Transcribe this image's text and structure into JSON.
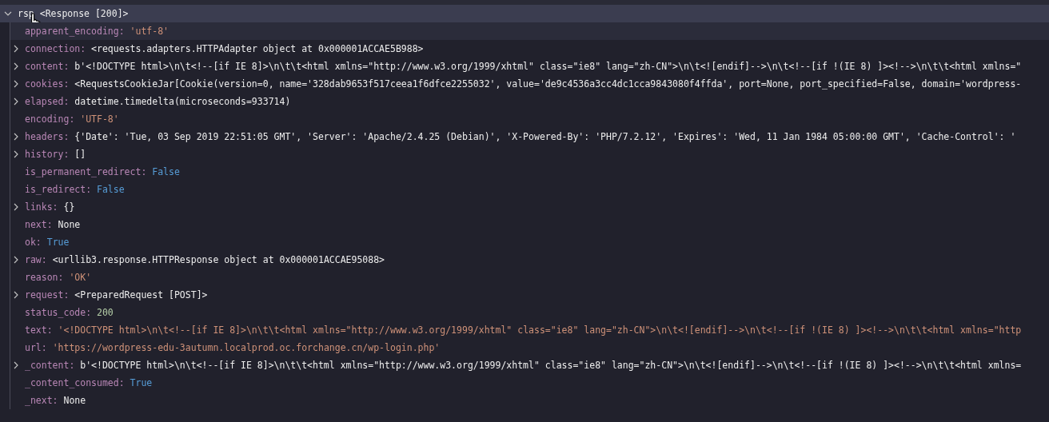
{
  "variable": {
    "name": "rsp",
    "value": "<Response [200]>",
    "expanded": true,
    "highlighted": true,
    "children": [
      {
        "name": "apparent_encoding:",
        "value": "'utf-8'",
        "kind": "string",
        "expandable": false,
        "highlighted": true
      },
      {
        "name": "connection:",
        "value": "<requests.adapters.HTTPAdapter object at 0x000001ACCAE5B988>",
        "kind": "object",
        "expandable": true,
        "expanded": false,
        "highlighted": false
      },
      {
        "name": "content:",
        "value": "b'<!DOCTYPE html>\\n\\t<!--[if IE 8]>\\n\\t\\t<html xmlns=\"http://www.w3.org/1999/xhtml\" class=\"ie8\" lang=\"zh-CN\">\\n\\t<![endif]-->\\n\\t<!--[if !(IE 8) ]><!-->\\n\\t\\t<html xmlns=\"",
        "kind": "object",
        "expandable": true,
        "expanded": false,
        "highlighted": false
      },
      {
        "name": "cookies:",
        "value": "<RequestsCookieJar[Cookie(version=0, name='328dab9653f517ceea1f6dfce2255032', value='de9c4536a3cc4dc1cca9843080f4ffda', port=None, port_specified=False, domain='wordpress-",
        "kind": "object",
        "expandable": true,
        "expanded": false,
        "highlighted": false
      },
      {
        "name": "elapsed:",
        "value": "datetime.timedelta(microseconds=933714)",
        "kind": "object",
        "expandable": true,
        "expanded": false,
        "highlighted": false
      },
      {
        "name": "encoding:",
        "value": "'UTF-8'",
        "kind": "string",
        "expandable": false,
        "highlighted": false
      },
      {
        "name": "headers:",
        "value": "{'Date': 'Tue, 03 Sep 2019 22:51:05 GMT', 'Server': 'Apache/2.4.25 (Debian)', 'X-Powered-By': 'PHP/7.2.12', 'Expires': 'Wed, 11 Jan 1984 05:00:00 GMT', 'Cache-Control': '",
        "kind": "object",
        "expandable": true,
        "expanded": false,
        "highlighted": false
      },
      {
        "name": "history:",
        "value": "[]",
        "kind": "object",
        "expandable": true,
        "expanded": false,
        "highlighted": false
      },
      {
        "name": "is_permanent_redirect:",
        "value": "False",
        "kind": "keyword",
        "expandable": false,
        "highlighted": false
      },
      {
        "name": "is_redirect:",
        "value": "False",
        "kind": "keyword",
        "expandable": false,
        "highlighted": false
      },
      {
        "name": "links:",
        "value": "{}",
        "kind": "object",
        "expandable": true,
        "expanded": false,
        "highlighted": false
      },
      {
        "name": "next:",
        "value": "None",
        "kind": "object",
        "expandable": false,
        "highlighted": false
      },
      {
        "name": "ok:",
        "value": "True",
        "kind": "keyword",
        "expandable": false,
        "highlighted": false
      },
      {
        "name": "raw:",
        "value": "<urllib3.response.HTTPResponse object at 0x000001ACCAE95088>",
        "kind": "object",
        "expandable": true,
        "expanded": false,
        "highlighted": false
      },
      {
        "name": "reason:",
        "value": "'OK'",
        "kind": "string",
        "expandable": false,
        "highlighted": false
      },
      {
        "name": "request:",
        "value": "<PreparedRequest [POST]>",
        "kind": "object",
        "expandable": true,
        "expanded": false,
        "highlighted": false
      },
      {
        "name": "status_code:",
        "value": "200",
        "kind": "number",
        "expandable": false,
        "highlighted": false
      },
      {
        "name": "text:",
        "value": "'<!DOCTYPE html>\\n\\t<!--[if IE 8]>\\n\\t\\t<html xmlns=\"http://www.w3.org/1999/xhtml\" class=\"ie8\" lang=\"zh-CN\">\\n\\t<![endif]-->\\n\\t<!--[if !(IE 8) ]><!-->\\n\\t\\t<html xmlns=\"http",
        "kind": "string",
        "expandable": false,
        "highlighted": false
      },
      {
        "name": "url:",
        "value": "'https://wordpress-edu-3autumn.localprod.oc.forchange.cn/wp-login.php'",
        "kind": "string",
        "expandable": false,
        "highlighted": false
      },
      {
        "name": "_content:",
        "value": "b'<!DOCTYPE html>\\n\\t<!--[if IE 8]>\\n\\t\\t<html xmlns=\"http://www.w3.org/1999/xhtml\" class=\"ie8\" lang=\"zh-CN\">\\n\\t<![endif]-->\\n\\t<!--[if !(IE 8) ]><!-->\\n\\t\\t<html xmlns=",
        "kind": "object",
        "expandable": true,
        "expanded": false,
        "highlighted": false
      },
      {
        "name": "_content_consumed:",
        "value": "True",
        "kind": "keyword",
        "expandable": false,
        "highlighted": false
      },
      {
        "name": "_next:",
        "value": "None",
        "kind": "object",
        "expandable": false,
        "highlighted": false
      }
    ]
  }
}
